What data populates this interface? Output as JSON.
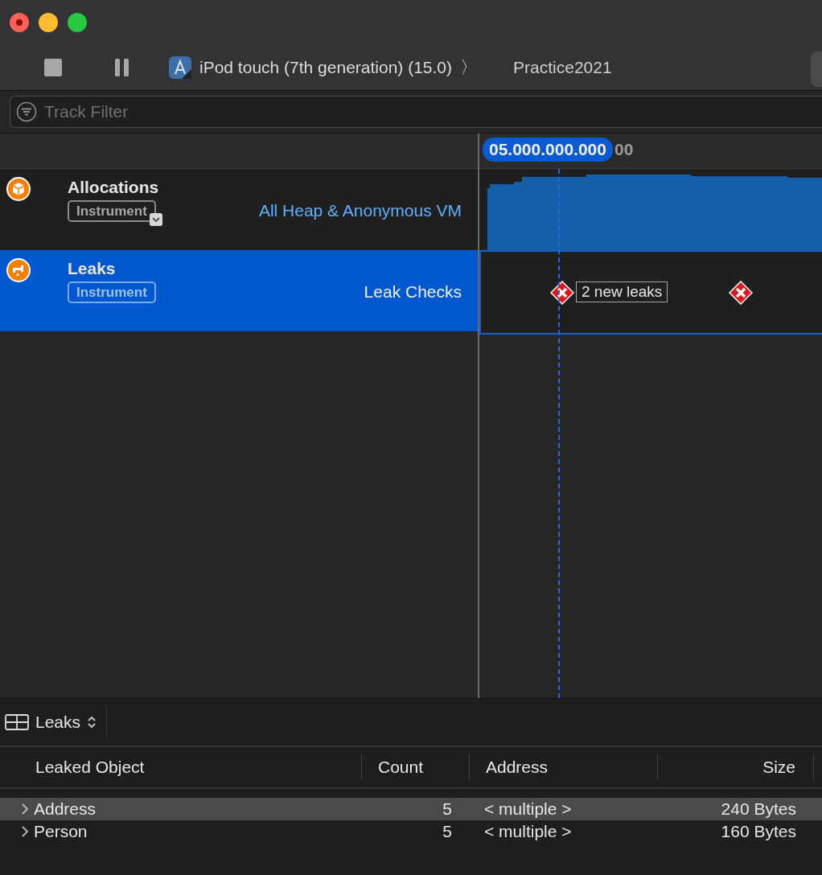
{
  "toolbar": {
    "device": "iPod touch (7th generation) (15.0)",
    "separator": "〉",
    "target": "Practice2021"
  },
  "track_filter": {
    "placeholder": "Track Filter"
  },
  "ruler": {
    "playhead_time": "05.000.000.000",
    "tick_label": "00"
  },
  "tracks": [
    {
      "name": "Allocations",
      "badge": "Instrument",
      "badge_menu": true,
      "detail": "All Heap & Anonymous VM",
      "selected": false,
      "kind": "allocations"
    },
    {
      "name": "Leaks",
      "badge": "Instrument",
      "badge_menu": false,
      "detail": "Leak Checks",
      "selected": true,
      "kind": "leaks",
      "markers": [
        {
          "kind": "labeled",
          "label": "2 new leaks"
        },
        {
          "kind": "plain"
        }
      ]
    }
  ],
  "detail_bar": {
    "view": "Leaks"
  },
  "table": {
    "columns": [
      "Leaked Object",
      "Count",
      "Address",
      "Size"
    ],
    "rows": [
      {
        "object": "Address",
        "count": "5",
        "address": "< multiple >",
        "size": "240 Bytes",
        "selected": true
      },
      {
        "object": "Person",
        "count": "5",
        "address": "< multiple >",
        "size": "160 Bytes",
        "selected": false
      }
    ]
  }
}
